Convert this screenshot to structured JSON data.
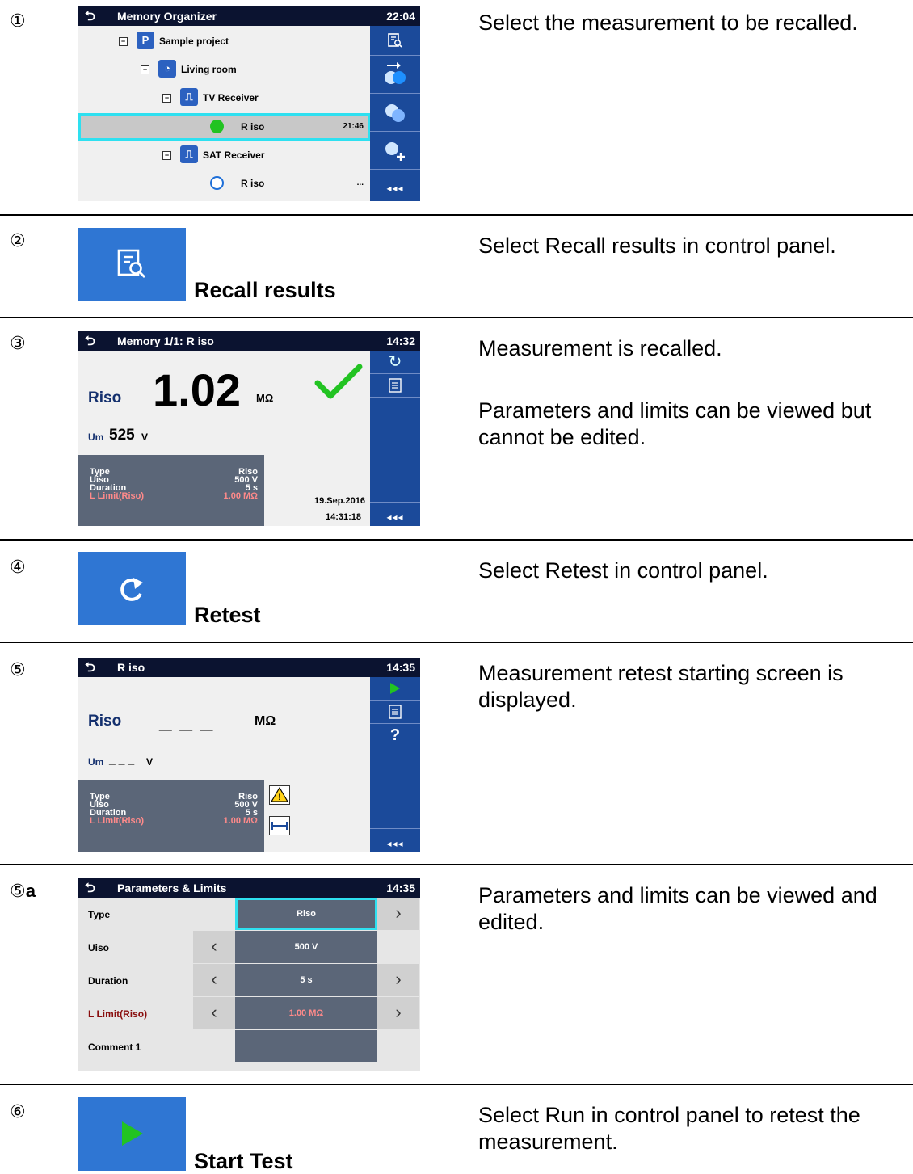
{
  "steps": [
    {
      "num": "①",
      "desc": [
        "Select the measurement to be recalled."
      ]
    },
    {
      "num": "②",
      "desc": [
        "Select Recall results in control panel."
      ],
      "button_label": "Recall results"
    },
    {
      "num": "③",
      "desc": [
        "Measurement is recalled.",
        "Parameters and limits can be viewed but cannot be edited."
      ]
    },
    {
      "num": "④",
      "desc": [
        "Select Retest in control panel."
      ],
      "button_label": "Retest"
    },
    {
      "num": "⑤",
      "desc": [
        "Measurement retest starting screen is displayed."
      ]
    },
    {
      "num": "⑤",
      "suffix": "a",
      "desc": [
        "Parameters and limits can be viewed and edited."
      ]
    },
    {
      "num": "⑥",
      "desc": [
        "Select Run in control panel to retest the measurement."
      ],
      "button_label": "Start Test"
    }
  ],
  "memory_organizer": {
    "title": "Memory Organizer",
    "time": "22:04",
    "tree": [
      {
        "label": "Sample project",
        "indent": 0
      },
      {
        "label": "Living room",
        "indent": 1
      },
      {
        "label": "TV Receiver",
        "indent": 2
      },
      {
        "label": "R iso",
        "indent": 3,
        "time": "21:46",
        "status": "pass",
        "selected": true
      },
      {
        "label": "SAT Receiver",
        "indent": 2
      },
      {
        "label": "R iso",
        "indent": 3,
        "time": "...",
        "status": "empty"
      }
    ],
    "more": "◂◂◂"
  },
  "recalled": {
    "title": "Memory 1/1: R iso",
    "time": "14:32",
    "main_label": "Riso",
    "main_value": "1.02",
    "main_unit": "MΩ",
    "sub_label": "Um",
    "sub_value": "525",
    "sub_unit": "V",
    "params": [
      {
        "k": "Type",
        "v": "Riso"
      },
      {
        "k": "Uiso",
        "v": "500 V"
      },
      {
        "k": "Duration",
        "v": "5 s"
      },
      {
        "k": "L Limit(Riso)",
        "v": "1.00 MΩ",
        "red": true
      }
    ],
    "date": "19.Sep.2016",
    "clock": "14:31:18",
    "more": "◂◂◂"
  },
  "retest": {
    "title": "R iso",
    "time": "14:35",
    "main_label": "Riso",
    "main_value": "_ _ _",
    "main_unit": "MΩ",
    "sub_label": "Um",
    "sub_value": "_ _ _",
    "sub_unit": "V",
    "params": [
      {
        "k": "Type",
        "v": "Riso"
      },
      {
        "k": "Uiso",
        "v": "500 V"
      },
      {
        "k": "Duration",
        "v": "5 s"
      },
      {
        "k": "L Limit(Riso)",
        "v": "1.00 MΩ",
        "red": true
      }
    ],
    "help": "?",
    "more": "◂◂◂"
  },
  "param_limits": {
    "title": "Parameters & Limits",
    "time": "14:35",
    "rows": [
      {
        "k": "Type",
        "v": "Riso",
        "left": false,
        "right": true,
        "highlight": true
      },
      {
        "k": "Uiso",
        "v": "500 V",
        "left": true,
        "right": false
      },
      {
        "k": "Duration",
        "v": "5 s",
        "left": true,
        "right": true
      },
      {
        "k": "L Limit(Riso)",
        "v": "1.00 MΩ",
        "left": true,
        "right": true,
        "red": true
      },
      {
        "k": "Comment 1",
        "v": "",
        "left": false,
        "right": false
      }
    ]
  },
  "colors": {
    "title_bar": "#0b1330",
    "panel": "#1b4a9a",
    "button_blue": "#2f76d3",
    "pass_green": "#22c322",
    "highlight": "#2ee0f0"
  }
}
